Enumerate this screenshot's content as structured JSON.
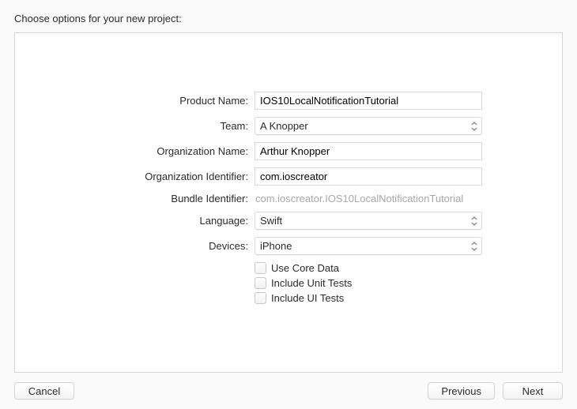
{
  "title": "Choose options for your new project:",
  "labels": {
    "product_name": "Product Name:",
    "team": "Team:",
    "organization_name": "Organization Name:",
    "organization_identifier": "Organization Identifier:",
    "bundle_identifier": "Bundle Identifier:",
    "language": "Language:",
    "devices": "Devices:"
  },
  "values": {
    "product_name": "IOS10LocalNotificationTutorial",
    "team": "A Knopper",
    "organization_name": "Arthur Knopper",
    "organization_identifier": "com.ioscreator",
    "bundle_identifier": "com.ioscreator.IOS10LocalNotificationTutorial",
    "language": "Swift",
    "devices": "iPhone"
  },
  "checkboxes": {
    "use_core_data": "Use Core Data",
    "include_unit_tests": "Include Unit Tests",
    "include_ui_tests": "Include UI Tests"
  },
  "buttons": {
    "cancel": "Cancel",
    "previous": "Previous",
    "next": "Next"
  }
}
